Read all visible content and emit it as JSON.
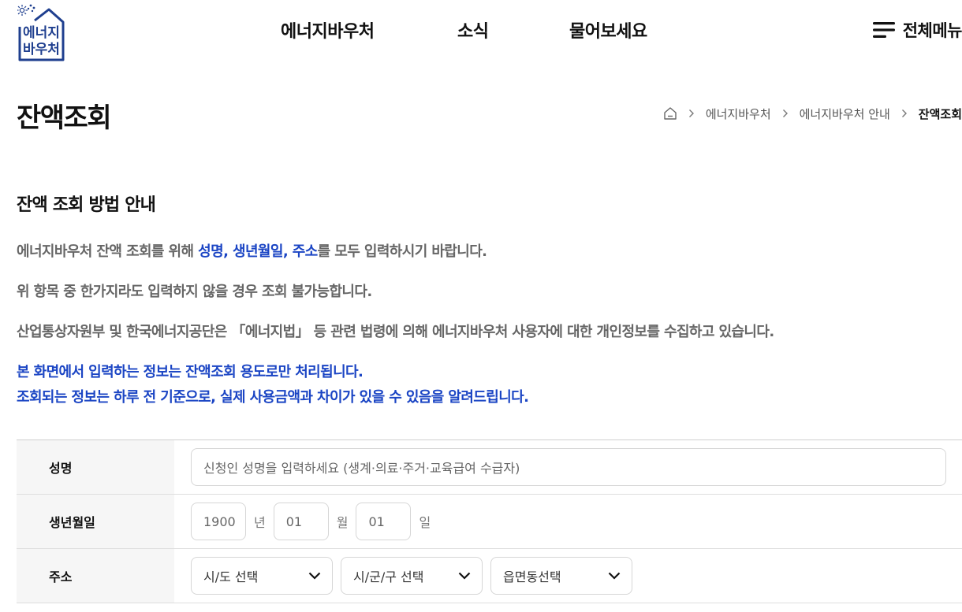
{
  "logo": {
    "line1": "에너지",
    "line2": "바우처"
  },
  "gnb": [
    {
      "label": "에너지바우처"
    },
    {
      "label": "소식"
    },
    {
      "label": "물어보세요"
    }
  ],
  "menu_all": {
    "label": "전체메뉴"
  },
  "page": {
    "title": "잔액조회"
  },
  "breadcrumb": {
    "item1": "에너지바우처",
    "item2": "에너지바우처 안내",
    "current": "잔액조회"
  },
  "guide": {
    "title": "잔액 조회 방법 안내",
    "line1_pre": "에너지바우처 잔액 조회를 위해 ",
    "line1_hl": "성명, 생년월일, 주소",
    "line1_post": "를 모두 입력하시기 바랍니다.",
    "line2": "위 항목 중 한가지라도 입력하지 않을 경우 조회 불가능합니다.",
    "line3": "산업통상자원부 및 한국에너지공단은 「에너지법」 등 관련 법령에 의해 에너지바우처 사용자에 대한 개인정보를 수집하고 있습니다.",
    "notice1": "본 화면에서 입력하는 정보는 잔액조회 용도로만 처리됩니다.",
    "notice2": "조회되는 정보는 하루 전 기준으로, 실제 사용금액과 차이가 있을 수 있음을 알려드립니다."
  },
  "form": {
    "name_label": "성명",
    "name_placeholder": "신청인 성명을 입력하세요 (생계·의료·주거·교육급여 수급자)",
    "birth_label": "생년월일",
    "birth_year": "1900",
    "year_unit": "년",
    "birth_month": "01",
    "month_unit": "월",
    "birth_day": "01",
    "day_unit": "일",
    "address_label": "주소",
    "sido": "시/도 선택",
    "sigungu": "시/군/구 선택",
    "eupmyeondong": "읍면동선택"
  },
  "colors": {
    "accent_blue": "#1b45c4",
    "logo_blue": "#1f3f8f",
    "text_gray": "#666666"
  }
}
